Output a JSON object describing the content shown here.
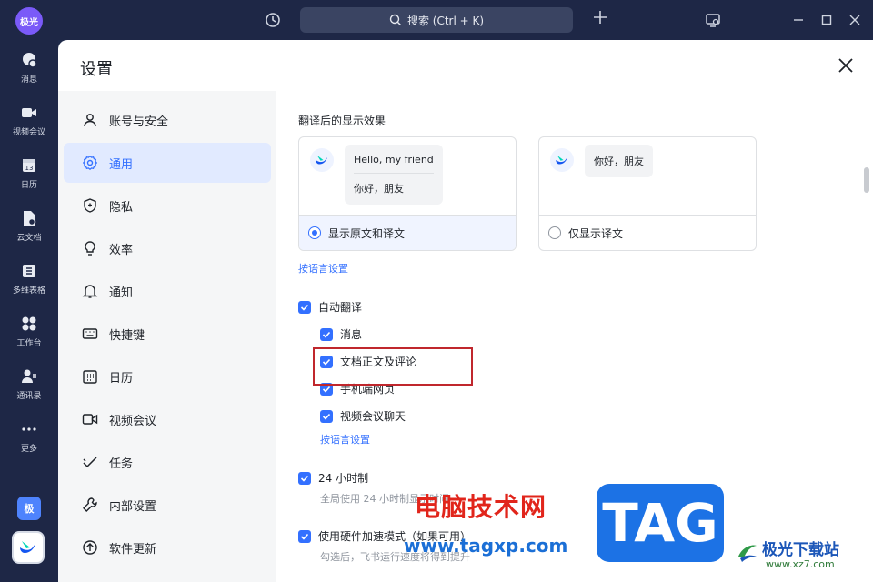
{
  "topbar": {
    "avatar_label": "极光",
    "search_placeholder": "搜索 (Ctrl + K)"
  },
  "rail": {
    "items": [
      {
        "label": "消息",
        "icon": "chat-bubble-icon"
      },
      {
        "label": "视频会议",
        "icon": "video-camera-icon"
      },
      {
        "label": "日历",
        "icon": "calendar-icon"
      },
      {
        "label": "云文档",
        "icon": "cloud-doc-icon"
      },
      {
        "label": "多维表格",
        "icon": "base-table-icon"
      },
      {
        "label": "工作台",
        "icon": "workplace-grid-icon"
      },
      {
        "label": "通讯录",
        "icon": "contacts-icon"
      },
      {
        "label": "更多",
        "icon": "more-dots-icon"
      }
    ],
    "ji_label": "极"
  },
  "dialog": {
    "title": "设置"
  },
  "nav": {
    "items": [
      {
        "label": "账号与安全",
        "icon": "user-icon",
        "active": false
      },
      {
        "label": "通用",
        "icon": "gear-icon",
        "active": true
      },
      {
        "label": "隐私",
        "icon": "shield-icon",
        "active": false
      },
      {
        "label": "效率",
        "icon": "bulb-icon",
        "active": false
      },
      {
        "label": "通知",
        "icon": "bell-icon",
        "active": false
      },
      {
        "label": "快捷键",
        "icon": "keyboard-icon",
        "active": false
      },
      {
        "label": "日历",
        "icon": "calendar-icon",
        "active": false
      },
      {
        "label": "视频会议",
        "icon": "video-camera-icon",
        "active": false
      },
      {
        "label": "任务",
        "icon": "task-check-icon",
        "active": false
      },
      {
        "label": "内部设置",
        "icon": "wrench-icon",
        "active": false
      },
      {
        "label": "软件更新",
        "icon": "arrow-up-circle-icon",
        "active": false
      }
    ]
  },
  "content": {
    "display_title": "翻译后的显示效果",
    "card1": {
      "line1": "Hello, my friend",
      "line2": "你好，朋友",
      "option": "显示原文和译文",
      "selected": true
    },
    "card2": {
      "line1": "你好，朋友",
      "option": "仅显示译文",
      "selected": false
    },
    "lang_link": "按语言设置",
    "auto_translate": "自动翻译",
    "sub_options": [
      "消息",
      "文档正文及评论",
      "手机端网页",
      "视频会议聊天"
    ],
    "lang_link2": "按语言设置",
    "hour24": "24 小时制",
    "hour24_desc": "全局使用 24 小时制显示时间",
    "hw_accel": "使用硬件加速模式（如果可用）",
    "hw_accel_desc": "勾选后，飞书运行速度将得到提升"
  },
  "watermark": {
    "cn_text": "电脑技术网",
    "url": "www.tagxp.com",
    "tag": "TAG",
    "site_name": "极光下载站",
    "site_url": "www.xz7.com"
  },
  "colors": {
    "accent": "#3370ff",
    "rail_bg": "#1e2746",
    "highlight_box": "#c0272d"
  }
}
